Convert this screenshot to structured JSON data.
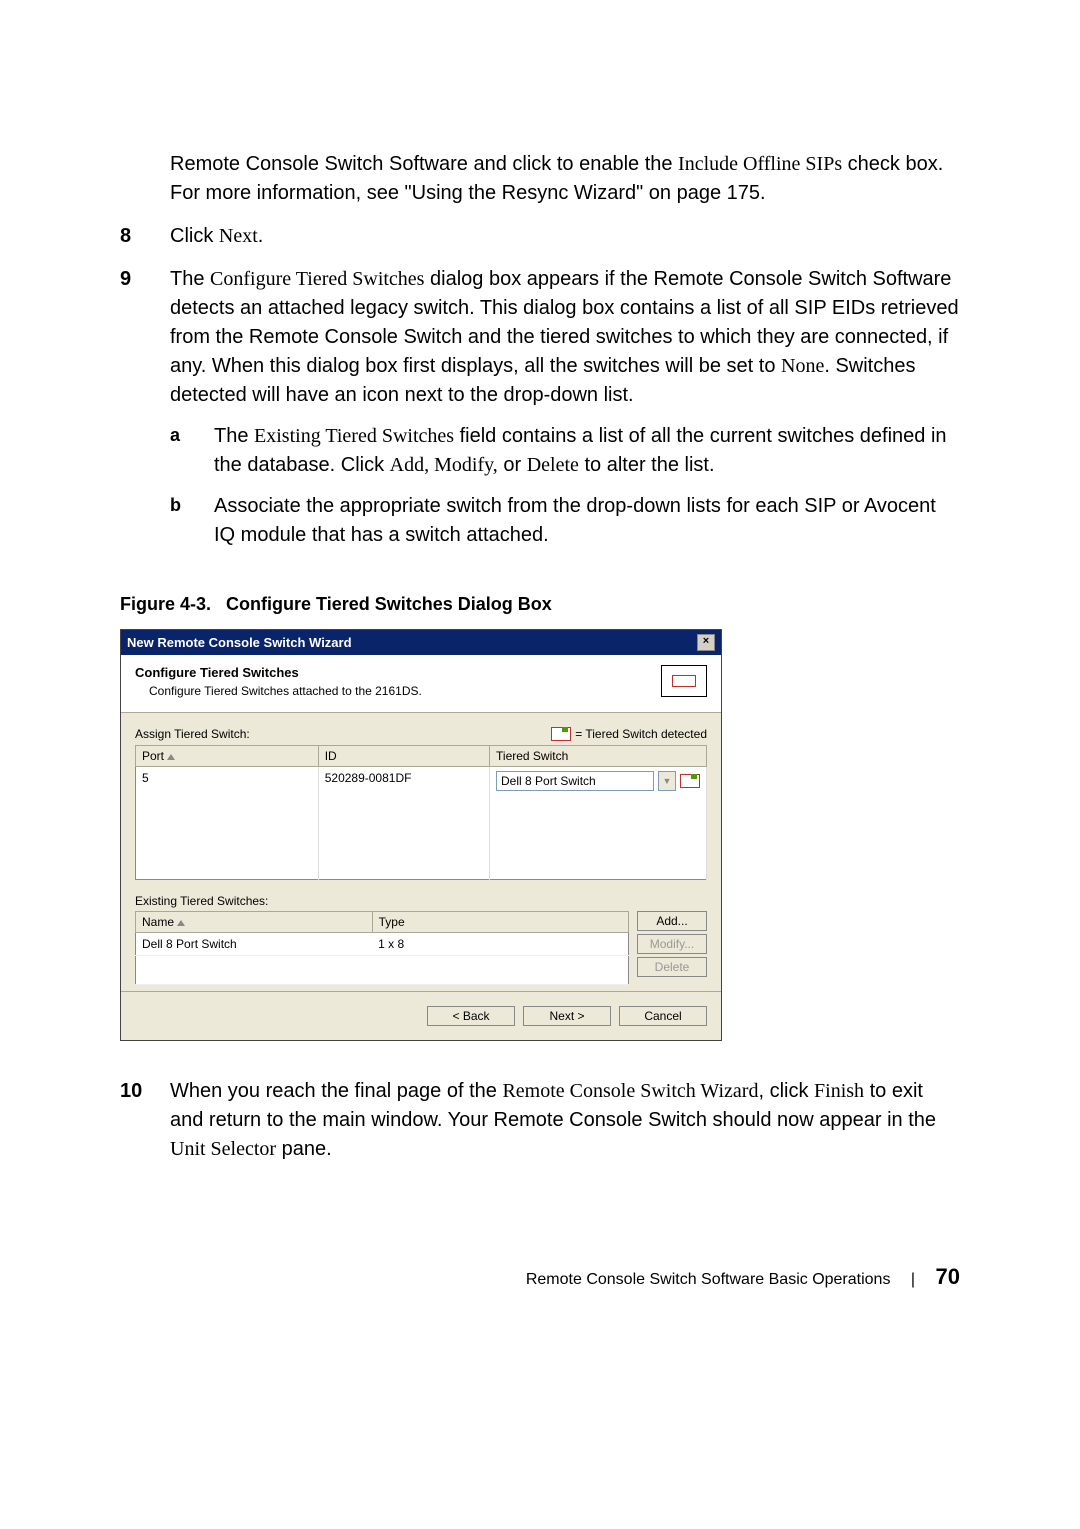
{
  "intro": {
    "line1a": "Remote Console Switch Software and click to enable the ",
    "line1b": "Include Offline SIPs",
    "line1c": " check box. For more information, see \"Using the Resync Wizard\" on page 175."
  },
  "step8": {
    "num": "8",
    "a": "Click ",
    "b": "Next",
    "c": "."
  },
  "step9": {
    "num": "9",
    "a": "The ",
    "b": "Configure Tiered Switches",
    "c": " dialog box appears if the Remote Console Switch Software detects an attached legacy switch. This dialog box contains a list of all SIP EIDs retrieved from the Remote Console Switch and the tiered switches to which they are connected, if any. When this dialog box first displays, all the switches will be set to ",
    "d": "None",
    "e": ". Switches detected will have an icon next to the drop-down list."
  },
  "step9a": {
    "letter": "a",
    "a": "The ",
    "b": "Existing Tiered Switches",
    "c": " field contains a list of all the current switches defined in the database. Click ",
    "d": "Add, Modify,",
    "e": " or ",
    "f": "Delete",
    "g": " to alter the list."
  },
  "step9b": {
    "letter": "b",
    "text": "Associate the appropriate switch from the drop-down lists for each SIP or Avocent IQ module that has a switch attached."
  },
  "figure_caption_a": "Figure 4-3.",
  "figure_caption_b": "Configure Tiered Switches Dialog Box",
  "dialog": {
    "title": "New Remote Console Switch Wizard",
    "heading": "Configure Tiered Switches",
    "subtitle": "Configure Tiered Switches attached to the 2161DS.",
    "assign_label": "Assign Tiered Switch:",
    "legend": " = Tiered Switch detected",
    "columns": {
      "port": "Port",
      "id": "ID",
      "ts": "Tiered Switch"
    },
    "row": {
      "port": "5",
      "id": "520289-0081DF",
      "ts": "Dell 8 Port Switch"
    },
    "existing_label": "Existing Tiered Switches:",
    "existing_columns": {
      "name": "Name",
      "type": "Type"
    },
    "existing_row": {
      "name": "Dell 8 Port Switch",
      "type": "1 x 8"
    },
    "side_buttons": {
      "add": "Add...",
      "modify": "Modify...",
      "delete": "Delete"
    },
    "footer": {
      "back": "< Back",
      "next": "Next >",
      "cancel": "Cancel"
    }
  },
  "step10": {
    "num": "10",
    "a": "When you reach the final page of the ",
    "b": "Remote Console Switch Wizard",
    "c": ", click ",
    "d": "Finish",
    "e": " to exit and return to the main window. Your Remote Console Switch should now appear in the ",
    "f": "Unit Selector",
    "g": " pane."
  },
  "footer": {
    "text": "Remote Console Switch Software Basic Operations",
    "page": "70"
  }
}
